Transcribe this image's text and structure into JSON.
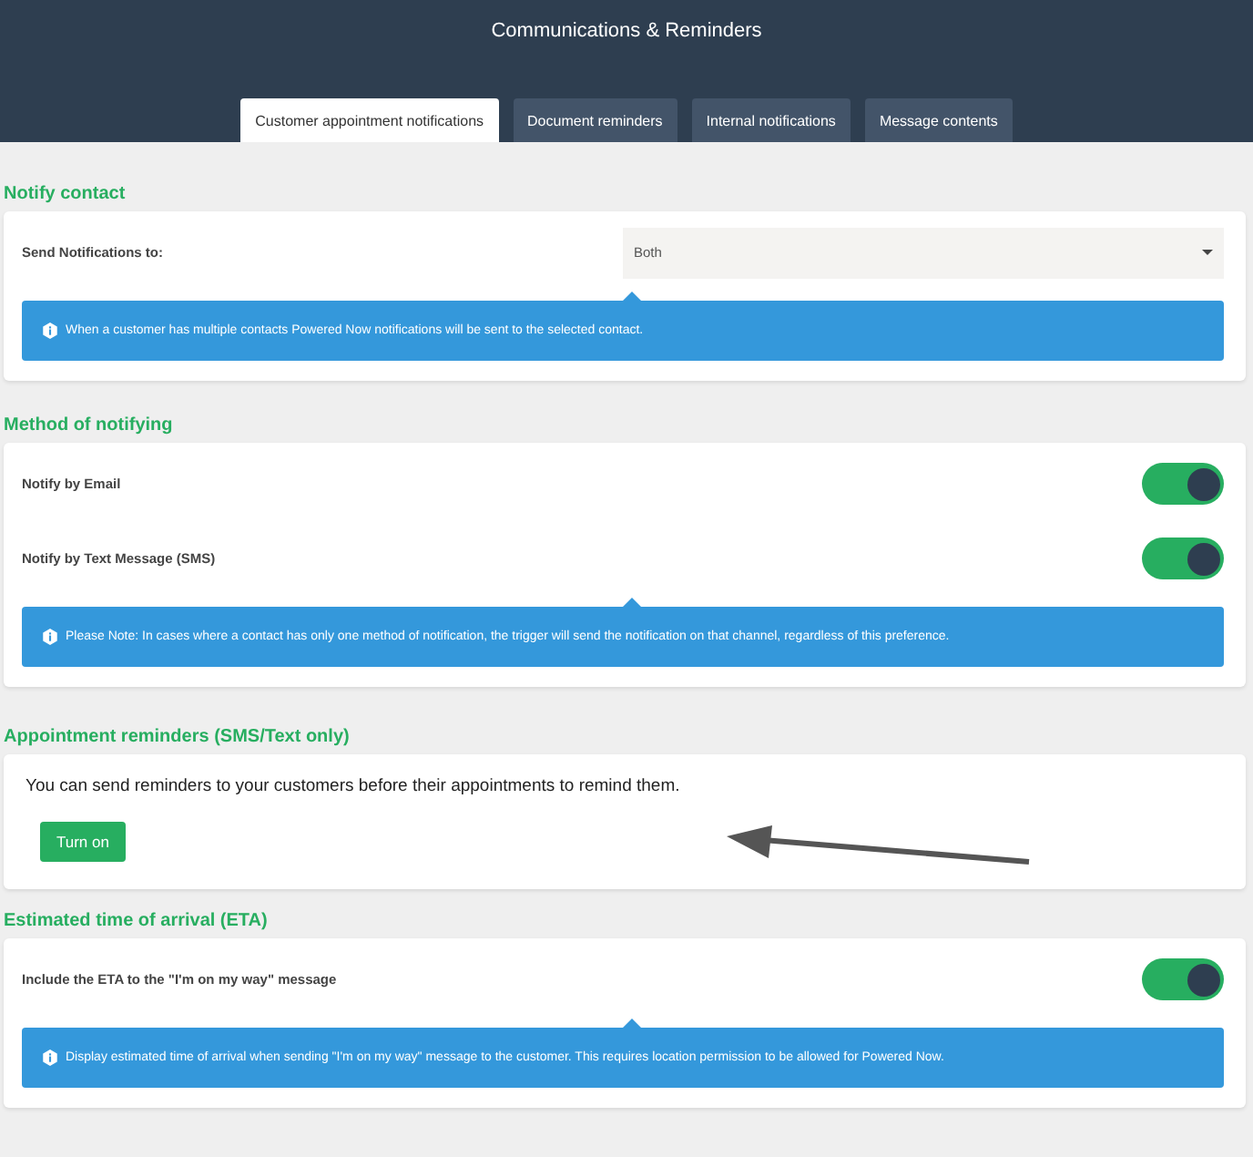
{
  "header": {
    "title": "Communications & Reminders"
  },
  "tabs": [
    {
      "label": "Customer appointment notifications",
      "selected": true
    },
    {
      "label": "Document reminders",
      "selected": false
    },
    {
      "label": "Internal notifications",
      "selected": false
    },
    {
      "label": "Message contents",
      "selected": false
    }
  ],
  "sections": [
    {
      "kind": "settings",
      "title": "Notify contact",
      "rows": [
        {
          "kind": "select",
          "label": "Send Notifications to:",
          "value": "Both"
        }
      ],
      "note": "When a customer has multiple contacts Powered Now notifications will be sent to the selected contact."
    },
    {
      "kind": "settings",
      "title": "Method of notifying",
      "rows": [
        {
          "kind": "toggle",
          "label": "Notify by Email",
          "on": true
        },
        {
          "kind": "toggle",
          "label": "Notify by Text Message (SMS)",
          "on": true
        }
      ],
      "note": "Please Note: In cases where a contact has only one method of notification, the trigger will send the notification on that channel, regardless of this preference."
    },
    {
      "kind": "action",
      "title": "Appointment reminders (SMS/Text only)",
      "text": "You can send reminders to your customers before their appointments to remind them.",
      "button": "Turn on"
    },
    {
      "kind": "settings",
      "title": "Estimated time of arrival (ETA)",
      "rows": [
        {
          "kind": "toggle",
          "label": "Include the ETA to the \"I'm on my way\" message",
          "on": true
        }
      ],
      "note": "Display estimated time of arrival when sending \"I'm on my way\" message to the customer. This requires location permission to be allowed for Powered Now."
    }
  ]
}
